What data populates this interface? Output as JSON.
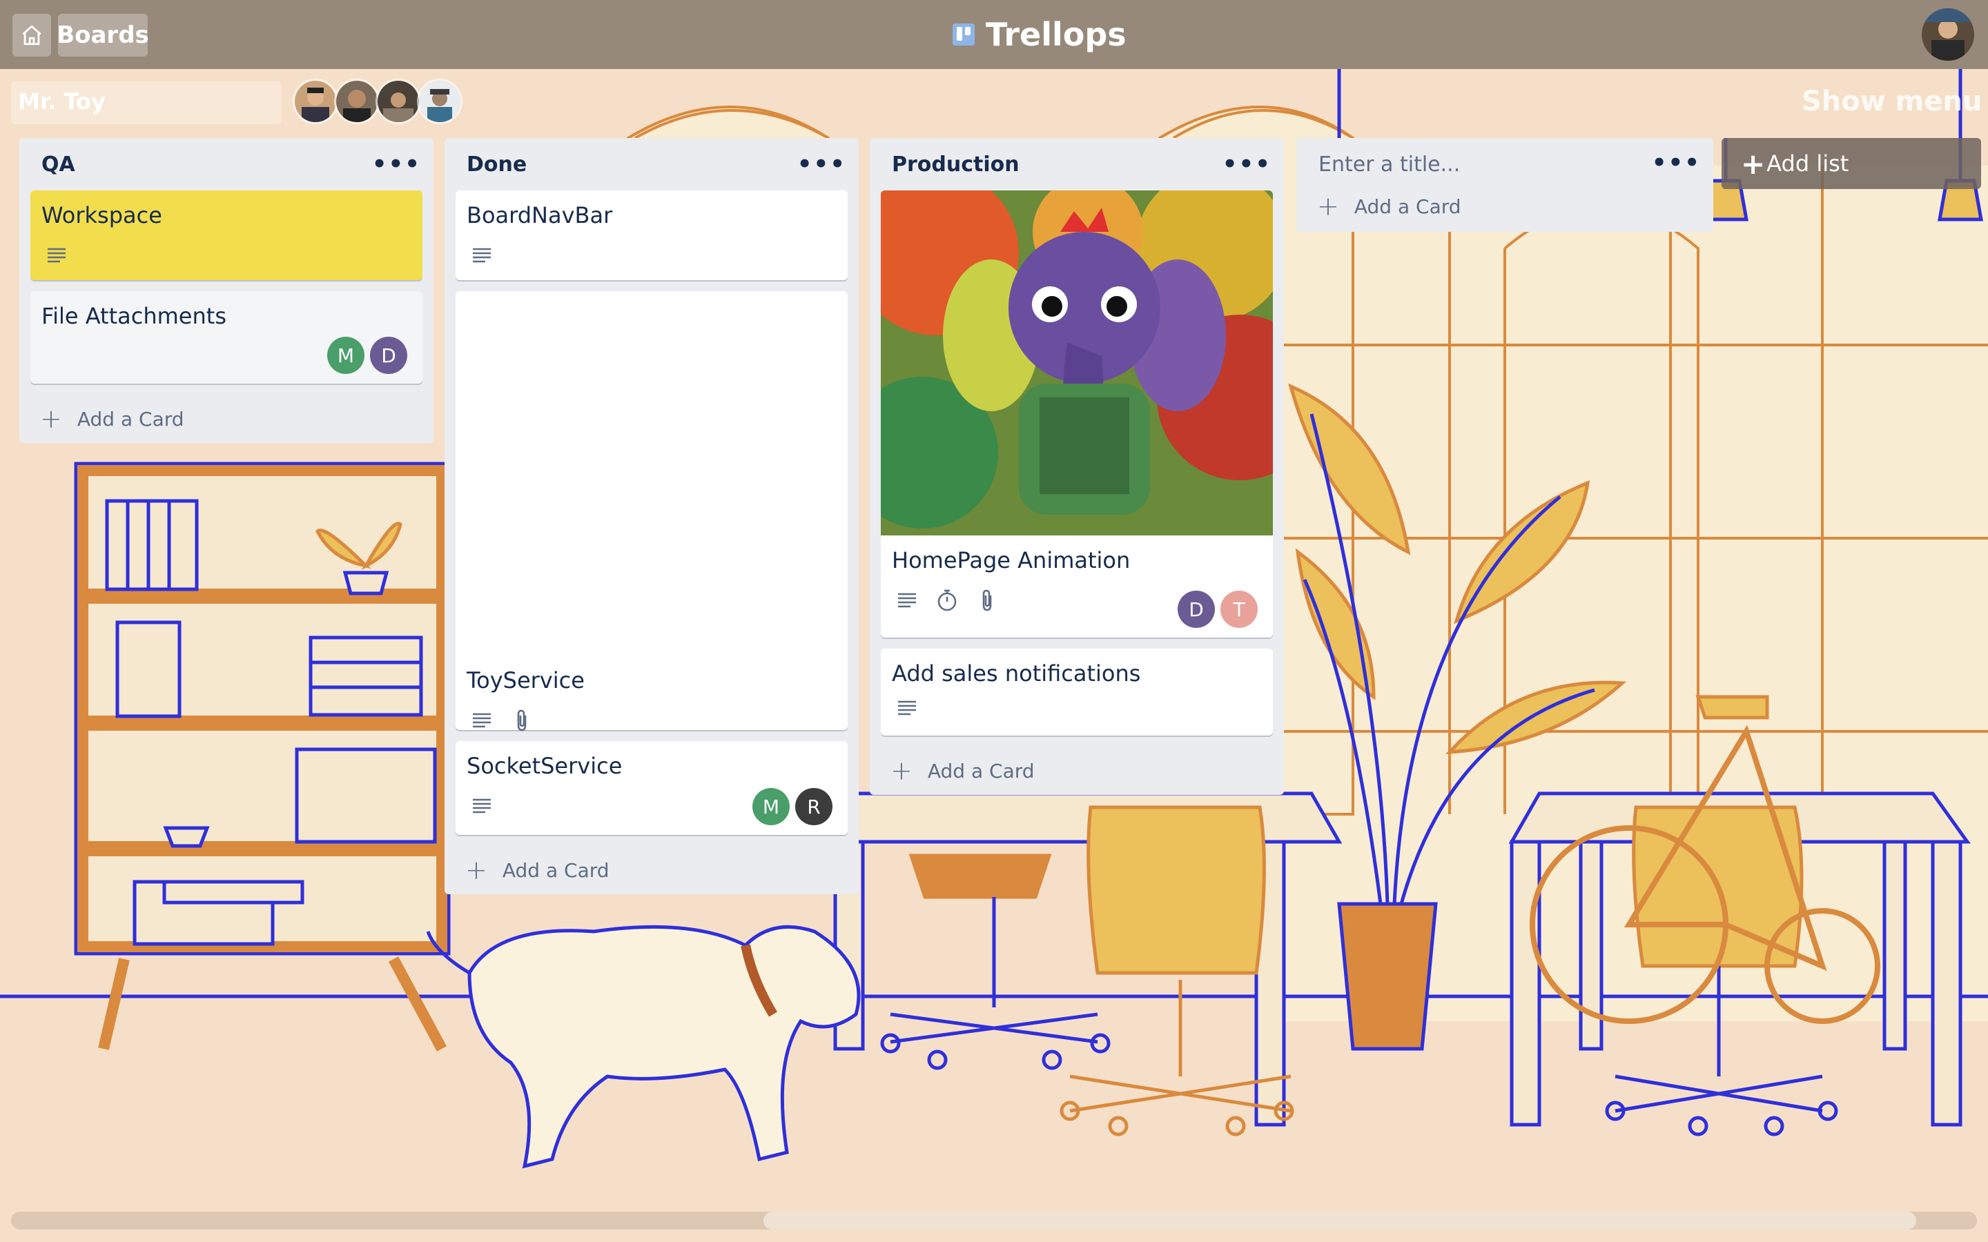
{
  "app": {
    "name": "Trellops",
    "boards_label": "Boards"
  },
  "board": {
    "name": "Mr. Toy",
    "show_menu_label": "Show menu"
  },
  "lists": [
    {
      "title": "QA",
      "menu": "•••",
      "cards": [
        {
          "title": "Workspace",
          "badges": [
            "description"
          ],
          "members": [],
          "color": "#f2dd4c"
        },
        {
          "title": "File Attachments",
          "badges": [],
          "members": [
            {
              "initial": "M",
              "color": "#4a9e6a"
            },
            {
              "initial": "D",
              "color": "#6b5b95"
            }
          ]
        }
      ],
      "add_card": "Add a Card"
    },
    {
      "title": "Done",
      "menu": "•••",
      "cards": [
        {
          "title": "BoardNavBar",
          "badges": [
            "description"
          ],
          "members": []
        },
        {
          "title": "ToyService",
          "badges": [
            "description",
            "attachment"
          ],
          "members": []
        },
        {
          "title": "SocketService",
          "badges": [
            "description"
          ],
          "members": [
            {
              "initial": "M",
              "color": "#4a9e6a"
            },
            {
              "initial": "R",
              "color": "#3c3c3c"
            }
          ]
        }
      ],
      "add_card": "Add a Card"
    },
    {
      "title": "Production",
      "menu": "•••",
      "cards": [
        {
          "title": "HomePage Animation",
          "badges": [
            "description",
            "timer",
            "attachment"
          ],
          "members": [
            {
              "initial": "D",
              "color": "#6b5b95"
            },
            {
              "initial": "T",
              "color": "#e8a29a"
            }
          ]
        },
        {
          "title": "Add sales notifications",
          "badges": [
            "description"
          ],
          "members": []
        }
      ],
      "add_card": "Add a Card"
    }
  ],
  "new_list": {
    "placeholder": "Enter a title...",
    "menu": "•••",
    "add_card": "Add a Card"
  },
  "add_list_label": "Add list",
  "icons": {
    "home": "home-icon",
    "description": "description-icon",
    "attachment": "paperclip-icon",
    "timer": "stopwatch-icon",
    "plus": "plus-icon"
  }
}
